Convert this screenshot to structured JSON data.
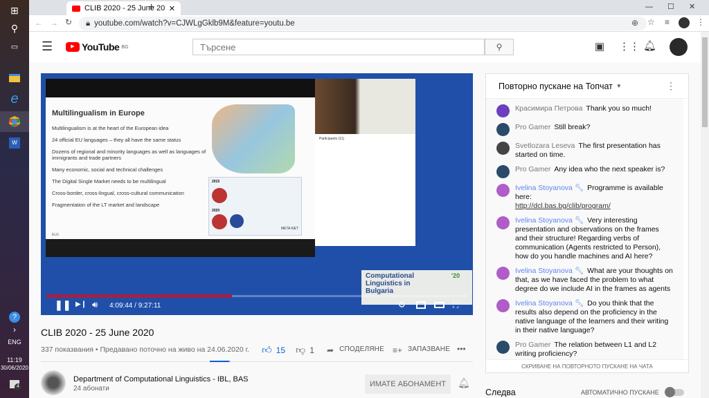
{
  "taskbar": {
    "lang": "ENG",
    "time": "11:19",
    "date": "30/06/2020",
    "notifications": "4"
  },
  "browser": {
    "tab_title": "CLIB 2020 - 25 June 2020 - YouTu",
    "url": "youtube.com/watch?v=CJWLgGklb9M&feature=youtu.be"
  },
  "header": {
    "logo": "YouTube",
    "region": "BG",
    "search_placeholder": "Търсене"
  },
  "video": {
    "slide_title": "Multilingualism in Europe",
    "bullets": [
      "Multilingualism is at the heart of the European idea",
      "24 official EU languages – they all have the same status",
      "Dozens of regional and minority languages as well as languages of immigrants and trade partners",
      "Many economic, social and technical challenges",
      "The Digital Single Market needs to be multilingual",
      "Cross-border, cross-lingual, cross-cultural communication",
      "Fragmentation of the LT market and landscape"
    ],
    "slide_footer": "ELG",
    "year1": "2015",
    "year2": "2020",
    "metanet": "META-NET",
    "participants_title": "Participants (11)",
    "brand": [
      "Computational",
      "Linguistics in",
      "Bulgaria"
    ],
    "brand_year": "'20",
    "time": "4:09:44 / 9:27:11",
    "progress": 0.44,
    "progress_color": "#ff0000"
  },
  "info": {
    "title": "CLIB 2020 - 25 June 2020",
    "meta": "337 показвания • Предавано поточно на живо на 24.06.2020 г.",
    "likes": "15",
    "dislikes": "1",
    "share": "СПОДЕЛЯНЕ",
    "save": "ЗАПАЗВАНЕ",
    "like_ratio": 0.94
  },
  "channel": {
    "name": "Department of Computational Linguistics - IBL, BAS",
    "subs": "24 абонати",
    "subscribe": "ИМАТЕ АБОНАМЕНТ"
  },
  "chat": {
    "title": "Повторно пускане на Топчат",
    "hide": "СКРИВАНЕ НА ПОВТОРНОТО ПУСКАНЕ НА ЧАТА",
    "messages": [
      {
        "author": "Красимира Петрова",
        "text": "Thank you so much!",
        "mod": false,
        "avatar": "#6b3fbf"
      },
      {
        "author": "Pro Gamer",
        "text": "Still break?",
        "mod": false,
        "avatar": "#2a4a6a"
      },
      {
        "author": "Svetlozara Leseva",
        "text": "The first presentation has started on time.",
        "mod": false,
        "avatar": "#444"
      },
      {
        "author": "Pro Gamer",
        "text": "Any idea who the next speaker is?",
        "mod": false,
        "avatar": "#2a4a6a"
      },
      {
        "author": "Ivelina Stoyanova",
        "text": "Programme is available here:",
        "link": "http://dcl.bas.bg/clib/program/",
        "mod": true,
        "avatar": "#b05cc9"
      },
      {
        "author": "Ivelina Stoyanova",
        "text": "Very interesting presentation and observations on the frames and their structure! Regarding verbs of communication (Agents restricted to Person), how do you handle machines and AI here?",
        "mod": true,
        "avatar": "#b05cc9"
      },
      {
        "author": "Ivelina Stoyanova",
        "text": "What are your thoughts on that, as we have faced the problem to what degree do we include AI in the frames as agents",
        "mod": true,
        "avatar": "#b05cc9"
      },
      {
        "author": "Ivelina Stoyanova",
        "text": "Do you think that the results also depend on the proficiency in the native language of the learners and their writing in their native language?",
        "mod": true,
        "avatar": "#b05cc9"
      },
      {
        "author": "Pro Gamer",
        "text": "The relation between L1 and L2 writing proficiency?",
        "mod": false,
        "avatar": "#2a4a6a"
      }
    ]
  },
  "upnext": {
    "label": "Следва",
    "autoplay": "АВТОМАТИЧНО ПУСКАНЕ",
    "autoplay_on": false
  }
}
